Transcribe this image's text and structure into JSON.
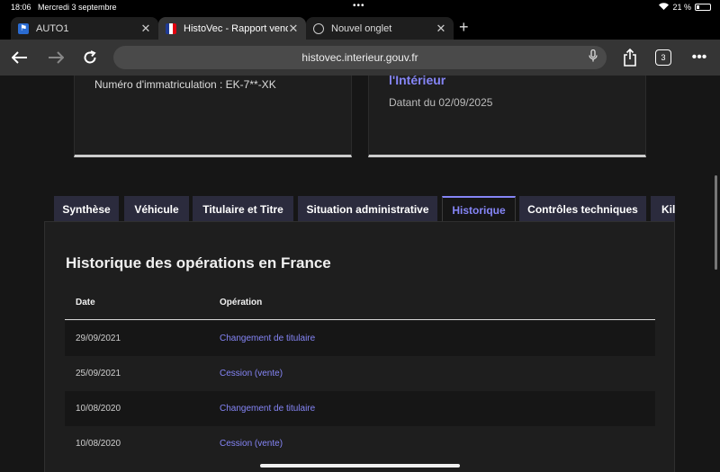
{
  "status_bar": {
    "time": "18:06",
    "date": "Mercredi 3 septembre",
    "battery": "21 %"
  },
  "browser_tabs": [
    {
      "label": "AUTO1",
      "active": false
    },
    {
      "label": "HistoVec - Rapport vendeur",
      "active": true
    },
    {
      "label": "Nouvel onglet",
      "active": false
    }
  ],
  "toolbar": {
    "url": "histovec.interieur.gouv.fr",
    "tab_count": "3"
  },
  "cards": {
    "plate": "Numéro d'immatriculation : EK-7**-XK",
    "ministry": "l'Intérieur",
    "dated": "Datant du 02/09/2025"
  },
  "nav_tabs": [
    {
      "label": "Synthèse"
    },
    {
      "label": "Véhicule"
    },
    {
      "label": "Titulaire et Titre"
    },
    {
      "label": "Situation administrative"
    },
    {
      "label": "Historique"
    },
    {
      "label": "Contrôles techniques"
    },
    {
      "label": "Kilométrage"
    }
  ],
  "history": {
    "title": "Historique des opérations en France",
    "col_date": "Date",
    "col_operation": "Opération",
    "rows": [
      {
        "date": "29/09/2021",
        "operation": "Changement de titulaire"
      },
      {
        "date": "25/09/2021",
        "operation": "Cession (vente)"
      },
      {
        "date": "10/08/2020",
        "operation": "Changement de titulaire"
      },
      {
        "date": "10/08/2020",
        "operation": "Cession (vente)"
      }
    ]
  },
  "colors": {
    "accent": "#8585f6",
    "background": "#161616",
    "panel": "#1e1e1e",
    "tab_background": "#2b2b3d"
  }
}
